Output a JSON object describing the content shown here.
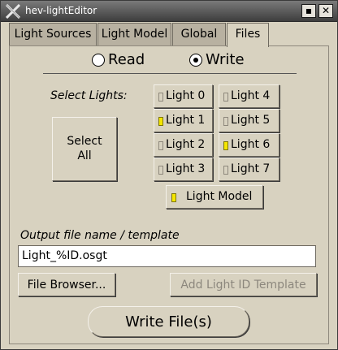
{
  "window": {
    "title": "hev-lightEditor"
  },
  "titlebar_buttons": {
    "maximize": "▪",
    "close": "✕"
  },
  "tabs": [
    {
      "label": "Light Sources"
    },
    {
      "label": "Light Model"
    },
    {
      "label": "Global"
    },
    {
      "label": "Files",
      "active": true
    }
  ],
  "mode": {
    "read_label": "Read",
    "write_label": "Write",
    "selected": "Write"
  },
  "select_lights_label": "Select Lights:",
  "select_all_label": "Select\nAll",
  "lights": [
    {
      "label": "Light 0",
      "on": false
    },
    {
      "label": "Light 1",
      "on": true
    },
    {
      "label": "Light 2",
      "on": false
    },
    {
      "label": "Light 3",
      "on": false
    },
    {
      "label": "Light 4",
      "on": false
    },
    {
      "label": "Light 5",
      "on": false
    },
    {
      "label": "Light 6",
      "on": true
    },
    {
      "label": "Light 7",
      "on": false
    }
  ],
  "light_model": {
    "label": "Light Model",
    "on": true
  },
  "output": {
    "label": "Output file name / template",
    "value": "Light_%ID.osgt"
  },
  "file_browser_label": "File Browser...",
  "add_template_label": "Add Light ID Template",
  "write_files_label": "Write File(s)",
  "colors": {
    "indicator_on": "#f5e600",
    "background": "#d8d2c0"
  },
  "icons": {
    "app_logo": "x-logo-icon"
  }
}
